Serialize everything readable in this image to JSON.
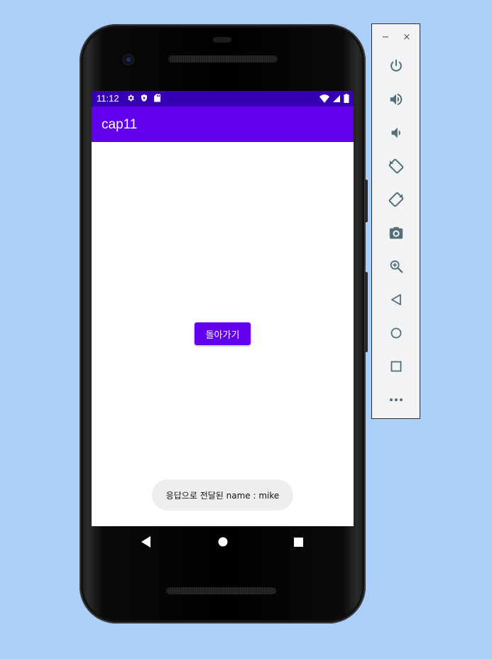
{
  "status_bar": {
    "time": "11:12"
  },
  "app_bar": {
    "title": "cap11"
  },
  "main": {
    "back_button_label": "돌아가기"
  },
  "toast": {
    "text": "응답으로 전달된 name : mike"
  },
  "colors": {
    "status_bar": "#3700b3",
    "app_bar": "#6200ee",
    "button": "#6200ee",
    "background": "#abcff9",
    "toast": "#eeeeee"
  },
  "emulator_panel": {
    "window_controls": {
      "minimize": "−",
      "close": "×"
    },
    "tools": [
      "power-icon",
      "volume-up-icon",
      "volume-down-icon",
      "rotate-left-icon",
      "rotate-right-icon",
      "camera-icon",
      "zoom-icon",
      "back-icon",
      "home-icon",
      "overview-icon",
      "more-icon"
    ]
  }
}
